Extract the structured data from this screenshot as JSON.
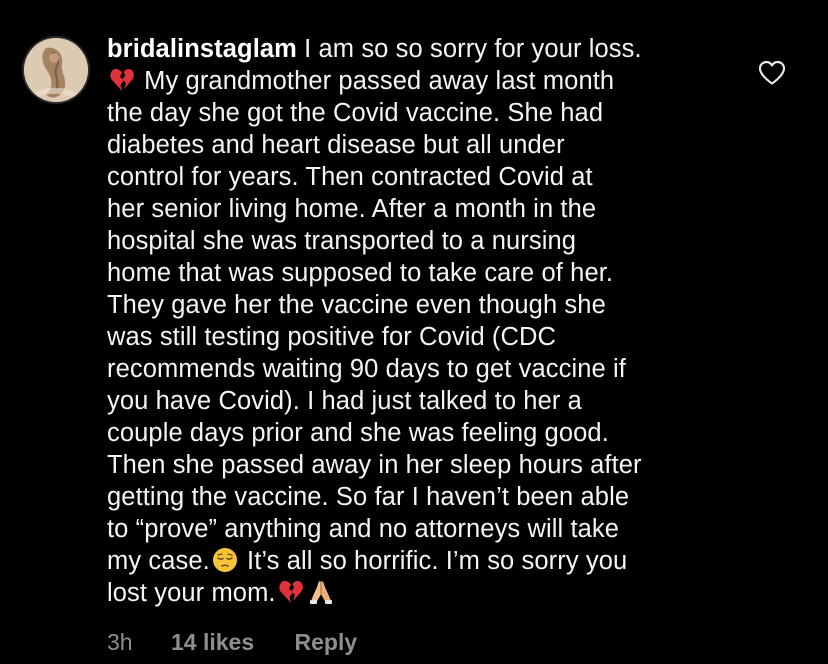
{
  "comment": {
    "username": "bridalinstaglam",
    "lines": [
      " I am so so sorry for your loss.",
      " My grandmother passed away last month",
      "the day she got the Covid vaccine.  She had",
      "diabetes and heart disease but all under",
      "control for years.  Then contracted Covid at",
      "her senior living home.  After a month in the",
      "hospital she was transported to a nursing",
      "home that was supposed to take care of her.",
      "They gave her the vaccine even though she",
      "was still testing positive for Covid (CDC",
      "recommends waiting 90 days to get vaccine if",
      "you have Covid). I had just talked to her a",
      "couple days prior and she was feeling good.",
      "Then she passed away in her sleep hours after",
      "getting the vaccine.  So far I haven’t been able",
      "to “prove” anything and no attorneys will take",
      "my case.",
      " It’s all so horrific.  I’m so sorry you",
      "lost your mom."
    ],
    "emojis": {
      "broken_heart": "broken-heart-emoji",
      "pensive_face": "pensive-face-emoji",
      "folded_hands": "folded-hands-emoji"
    },
    "footer": {
      "time": "3h",
      "likes": "14 likes",
      "reply": "Reply"
    }
  },
  "colors": {
    "background": "#000000",
    "text": "#f5f5f5",
    "muted": "#8e8e8e"
  }
}
